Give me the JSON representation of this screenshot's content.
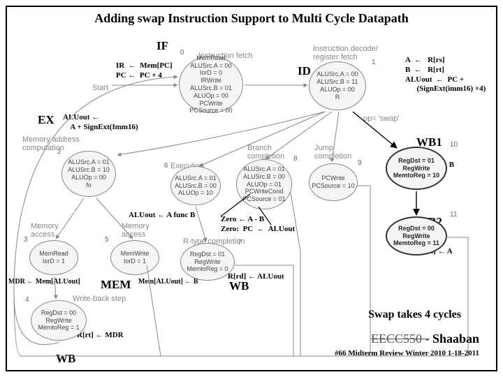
{
  "title": "Adding swap  Instruction Support to Multi Cycle Datapath",
  "stages": {
    "IF": "IF",
    "ID": "ID",
    "EX": "EX",
    "MEM": "MEM",
    "WB": "WB",
    "WB1": "WB1",
    "WB2": "WB2"
  },
  "notes": {
    "if": "IR  ←  Mem[PC]\nPC ←  PC + 4",
    "id": "A  ←   R[rs]\nB  ←   R[rt]\nALUout  ←  PC +\n      (SignExt(imm16) ×4)",
    "ex": "ALUout ←\n    A + SignExt(Imm16)",
    "wb1": "R[rd]  ←   B",
    "wb2": "R[rt]  ←   A",
    "aluoutfunc": "ALUout ← A  func  B",
    "zero": "Zero ← A - B\nZero:  PC  ←  ALUout",
    "rrd_aluout": "R[rd] ← ALUout",
    "mdr": "MDR ← Mem[ALUout]",
    "mem_store": "Mem[ALUout] ← B",
    "rrt_mdr": "R[rt]  ←  MDR",
    "swap": "Swap takes 4 cycles"
  },
  "states": {
    "s0": "MemRead\nALUSrc.A = 00\nIorD = 0\nIRWrite\nALUSrc.B = 01\nALUOp = 00\nPCWrite\nPCSource = 00",
    "s1": "ALUSrc.A = 00\nALUSrc.B = 11\nALUOp = 00\nR",
    "s2": "ALUSrc.A = 01\nALUSrc.B = 10\nALUOp = 00\nfo",
    "s3": "MemRead\nIorD = 1",
    "s4": "RegDst = 00\nRegWrite\nMemtoReg = 1",
    "s5": "MemWrite\nIorD = 1",
    "s6": "ALUSrc.A = 01\nALUSrc.B = 00\nALUOp = 10",
    "s7": "RegDst = 01\nRegWrite\nMemtoReg = 0",
    "s8": "ALUSrc.A = 01\nALUSrc.B = 00\nALUOp = 01\nPCWriteCond\nPCSource = 01",
    "s9": "PCWrite\nPCSource = 10",
    "s10": "RegDst = 01\nRegWrite\nMemtoReg = 10",
    "s11": "RegDst = 00\nRegWrite\nMemtoReg = 11"
  },
  "faded": {
    "if_hdr": "Instruction fetch",
    "id_hdr": "Instruction decode/\nregister fetch",
    "mac": "Memory address\ncomputation",
    "exec": "Execution",
    "branch": "Branch\ncompletion",
    "jump": "Jump\ncompletion",
    "ma1": "Memory\naccess",
    "ma2": "Memory\naccess",
    "rtype": "R-type completion",
    "wbs": "Write-back step",
    "opswap": "op= 'swap'",
    "start": "Start"
  },
  "footer": {
    "code": "EECC550 -",
    "name": "Shaaban",
    "line2": "#66   Midterm Review   Winter 2010  1-18-2011"
  }
}
